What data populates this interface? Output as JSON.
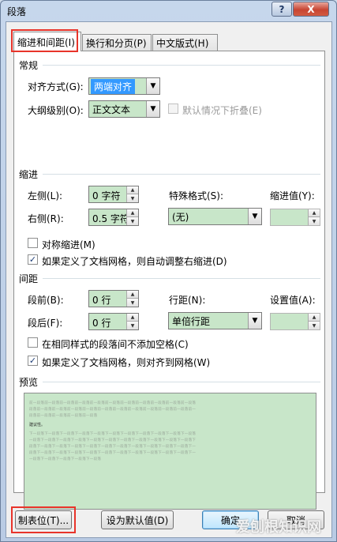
{
  "window": {
    "title": "段落",
    "help_label": "?",
    "close_label": "X"
  },
  "tabs": [
    {
      "label": "缩进和间距(I)"
    },
    {
      "label": "换行和分页(P)"
    },
    {
      "label": "中文版式(H)"
    }
  ],
  "general": {
    "heading": "常规",
    "alignment_label": "对齐方式(G):",
    "alignment_value": "两端对齐",
    "outline_label": "大纲级别(O):",
    "outline_value": "正文文本",
    "collapse_label": "默认情况下折叠(E)"
  },
  "indent": {
    "heading": "缩进",
    "left_label": "左侧(L):",
    "left_value": "0 字符",
    "right_label": "右侧(R):",
    "right_value": "0.5 字符",
    "special_label": "特殊格式(S):",
    "special_value": "(无)",
    "by_label": "缩进值(Y):",
    "by_value": "",
    "mirror_label": "对称缩进(M)",
    "grid_label": "如果定义了文档网格，则自动调整右缩进(D)"
  },
  "spacing": {
    "heading": "间距",
    "before_label": "段前(B):",
    "before_value": "0 行",
    "after_label": "段后(F):",
    "after_value": "0 行",
    "line_label": "行距(N):",
    "line_value": "单倍行距",
    "at_label": "设置值(A):",
    "at_value": "",
    "no_space_label": "在相同样式的段落间不添加空格(C)",
    "snap_label": "如果定义了文档网格，则对齐到网格(W)"
  },
  "preview": {
    "heading": "预览",
    "prev_lines": [
      "前一段落前一段落前一段落前一段落前一段落前一段落前一段落前一段落前一段落前一段落前一段落",
      "段落前一段落前一段落前一段落前一段落前一段落前一段落前一段落前一段落前一段落前一段落前一",
      "段落前一段落前一段落前一段落前一段落"
    ],
    "main_text": "建议性。",
    "next_lines": [
      "下一段落下一段落下一段落下一段落下一段落下一段落下一段落下一段落下一段落下一段落下一段落",
      "一段落下一段落下一段落下一段落下一段落下一段落下一段落下一段落下一段落下一段落下一段落下",
      "段落下一段落下一段落下一段落下一段落下一段落下一段落下一段落下一段落下一段落下一段落下一",
      "段落下一段落下一段落下一段落下一段落下一段落下一段落下一段落下一段落下一段落下一段落下一",
      "一段落下一段落下一段落下一段落下一段落"
    ]
  },
  "buttons": {
    "tabs_label": "制表位(T)...",
    "default_label": "设为默认值(D)",
    "ok_label": "确定",
    "cancel_label": "取消"
  },
  "watermark": "爱刨根知识网",
  "checkbox_states": {
    "collapse": false,
    "mirror": false,
    "grid": true,
    "no_space": false,
    "snap": true
  },
  "colors": {
    "field_green": "#c8e6c9",
    "highlight_red": "#e8342a",
    "selection_blue": "#3399ff"
  }
}
